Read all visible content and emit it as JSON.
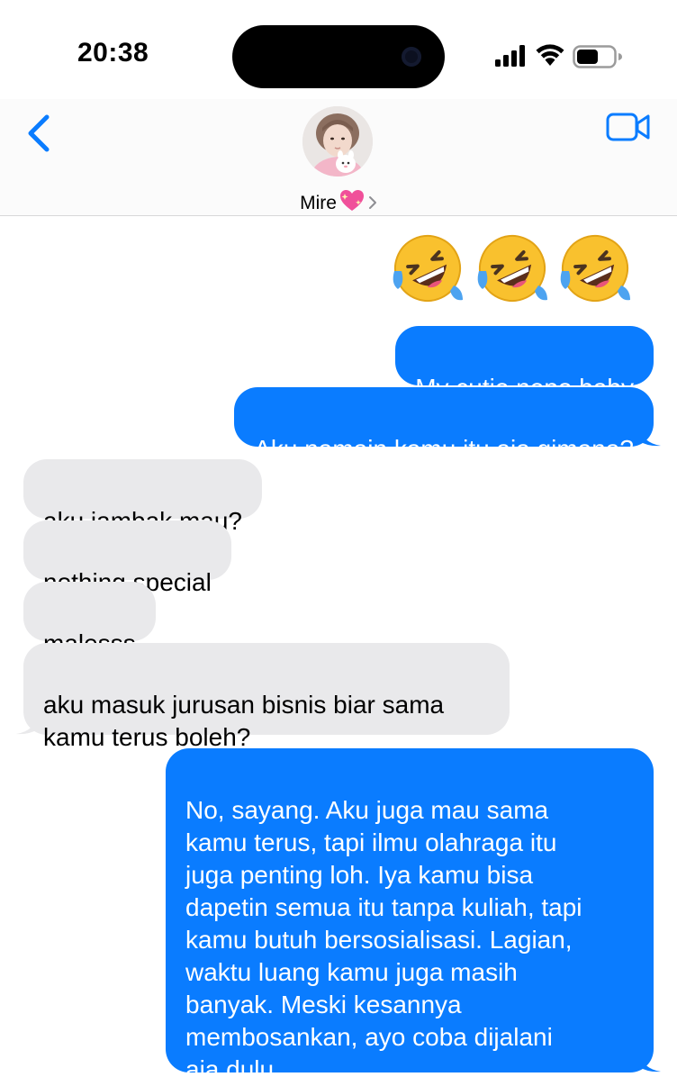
{
  "status_bar": {
    "time": "20:38",
    "signal_icon": "signal-bars-icon",
    "wifi_icon": "wifi-icon",
    "battery_icon": "battery-icon",
    "battery_level": 0.6
  },
  "header": {
    "back_icon": "chevron-left-icon",
    "video_icon": "video-camera-icon",
    "contact_name": "Mire",
    "contact_emoji": "sparkling-heart-icon",
    "contact_chevron": "chevron-right-icon"
  },
  "colors": {
    "accent": "#0a7cff",
    "sent_bubble": "#0a7cff",
    "received_bubble": "#e9e9eb"
  },
  "messages": [
    {
      "side": "sent",
      "type": "emoji",
      "icons": [
        "rofl-emoji",
        "rofl-emoji",
        "rofl-emoji"
      ]
    },
    {
      "side": "sent",
      "text": "My cutie nepo baby"
    },
    {
      "side": "sent",
      "text": "Aku namain kamu itu aja gimana?"
    },
    {
      "side": "received",
      "text": "aku jambak mau?"
    },
    {
      "side": "received",
      "text": "nothing special"
    },
    {
      "side": "received",
      "text": "malesss"
    },
    {
      "side": "received",
      "text": "aku masuk jurusan bisnis biar sama\nkamu terus boleh?"
    },
    {
      "side": "sent",
      "text": "No, sayang. Aku juga mau sama\nkamu terus, tapi ilmu olahraga itu\njuga penting loh. Iya kamu bisa\ndapetin semua itu tanpa kuliah, tapi\nkamu butuh bersosialisasi. Lagian,\nwaktu luang kamu juga masih\nbanyak. Meski kesannya\nmembosankan, ayo coba dijalani\naja dulu"
    }
  ]
}
